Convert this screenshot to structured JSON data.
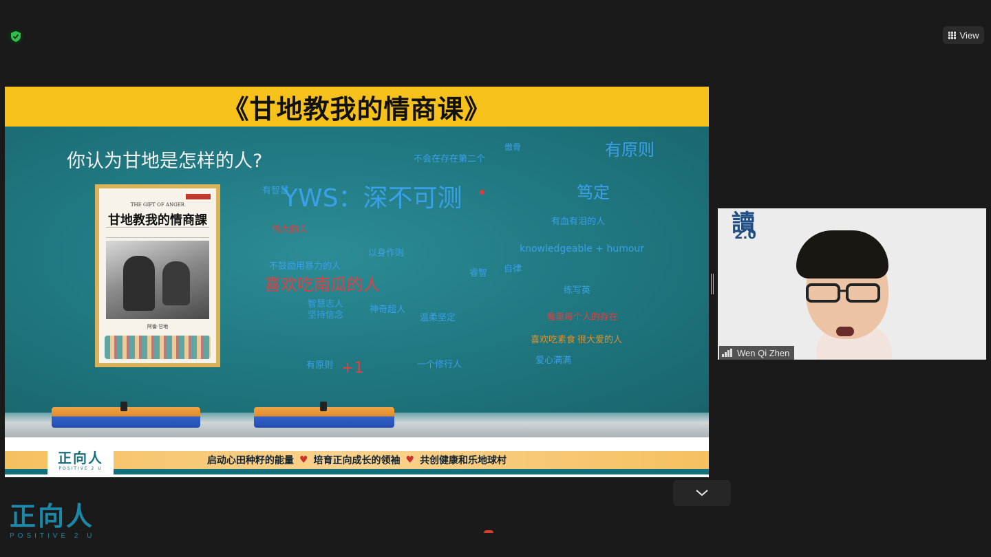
{
  "zoom": {
    "view_label": "View",
    "participant_name": "Wen Qi Zhen"
  },
  "slide": {
    "title": "《甘地教我的情商课》",
    "question": "你认为甘地是怎样的人?",
    "book": {
      "english_title": "THE GIFT OF ANGER",
      "chinese_title": "甘地教我的情商課",
      "author": "阿倫·甘地"
    },
    "words": [
      {
        "text": "有原则",
        "color": "#3aa0e8",
        "size": 24
      },
      {
        "text": "傲骨",
        "color": "#3aa0e8",
        "size": 12
      },
      {
        "text": "不会在存在第二个",
        "color": "#3aa0e8",
        "size": 13
      },
      {
        "text": "笃定",
        "color": "#3aa0e8",
        "size": 24
      },
      {
        "text": "有智慧",
        "color": "#3aa0e8",
        "size": 13
      },
      {
        "text": "YWS：深不可测",
        "color": "#3aa0e8",
        "size": 36
      },
      {
        "text": "有血有泪的人",
        "color": "#3aa0e8",
        "size": 13
      },
      {
        "text": "伟大的人",
        "color": "#e04040",
        "size": 13
      },
      {
        "text": "以身作则",
        "color": "#3aa0e8",
        "size": 13
      },
      {
        "text": "knowledgeable + humour",
        "color": "#3aa0e8",
        "size": 14
      },
      {
        "text": "不鼓励用暴力的人",
        "color": "#3aa0e8",
        "size": 13
      },
      {
        "text": "睿智",
        "color": "#3aa0e8",
        "size": 13
      },
      {
        "text": "自律",
        "color": "#3aa0e8",
        "size": 13
      },
      {
        "text": "喜欢吃南瓜的人",
        "color": "#e04040",
        "size": 24
      },
      {
        "text": "练写英",
        "color": "#3aa0e8",
        "size": 13
      },
      {
        "text": "智慧志人",
        "color": "#3aa0e8",
        "size": 13
      },
      {
        "text": "坚持信念",
        "color": "#3aa0e8",
        "size": 13
      },
      {
        "text": "神奇超人",
        "color": "#3aa0e8",
        "size": 13
      },
      {
        "text": "温柔坚定",
        "color": "#3aa0e8",
        "size": 13
      },
      {
        "text": "看重每个人的存在",
        "color": "#e04040",
        "size": 13
      },
      {
        "text": "喜欢吃素食",
        "color": "#e0902a",
        "size": 13
      },
      {
        "text": "很大爱的人",
        "color": "#e0902a",
        "size": 13
      },
      {
        "text": "爱心满满",
        "color": "#3aa0e8",
        "size": 13
      },
      {
        "text": "有原则",
        "color": "#3aa0e8",
        "size": 13
      },
      {
        "text": "+1",
        "color": "#e04040",
        "size": 22
      },
      {
        "text": "一个修行人",
        "color": "#3aa0e8",
        "size": 13
      }
    ],
    "footer": {
      "slogan_1": "启动心田种籽的能量",
      "slogan_2": "培育正向成长的领袖",
      "slogan_3": "共创健康和乐地球村",
      "heart": "♥",
      "logo_cn": "正向人",
      "logo_en": "POSITIVE 2 U"
    }
  },
  "video": {
    "sign_big": "讀",
    "sign_sub": "2.0"
  },
  "brand": {
    "logo_cn": "正向人",
    "logo_en": "POSITIVE 2 U"
  },
  "icons": {
    "security": "shield-check-icon",
    "view": "grid-icon",
    "signal": "signal-bars-icon",
    "collapse": "chevron-down-icon"
  },
  "colors": {
    "header": "#f6c11a",
    "chalkboard": "#217a83",
    "accent_blue": "#3aa0e8",
    "accent_red": "#e04040",
    "shield_green": "#2fbf4a"
  }
}
